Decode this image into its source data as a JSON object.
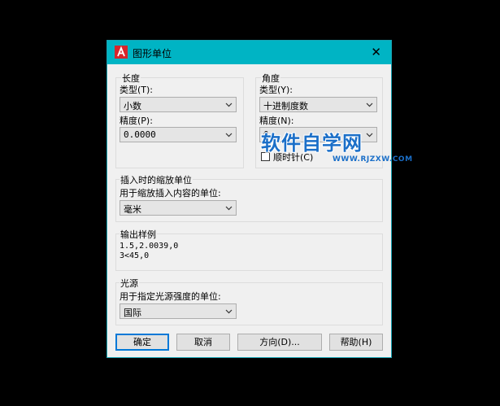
{
  "dialog": {
    "title": "图形单位",
    "close_label": "✕"
  },
  "length": {
    "group_title": "长度",
    "type_label": "类型(T):",
    "type_value": "小数",
    "precision_label": "精度(P):",
    "precision_value": "0.0000"
  },
  "angle": {
    "group_title": "角度",
    "type_label": "类型(Y):",
    "type_value": "十进制度数",
    "precision_label": "精度(N):",
    "precision_value": "0",
    "clockwise_label": "顺时针(C)",
    "clockwise_checked": false
  },
  "insertion": {
    "group_title": "插入时的缩放单位",
    "units_label": "用于缩放插入内容的单位:",
    "units_value": "毫米"
  },
  "sample": {
    "group_title": "输出样例",
    "line1": "1.5,2.0039,0",
    "line2": "3<45,0"
  },
  "lighting": {
    "group_title": "光源",
    "units_label": "用于指定光源强度的单位:",
    "units_value": "国际"
  },
  "buttons": {
    "ok": "确定",
    "cancel": "取消",
    "direction": "方向(D)...",
    "help": "帮助(H)"
  },
  "watermark": {
    "title": "软件自学网",
    "url": "WWW.RJZXW.COM"
  },
  "colors": {
    "titlebar": "#00b4c4",
    "accent": "#0078d7",
    "app_icon": "#d9242a",
    "watermark": "#1b6fc8"
  }
}
